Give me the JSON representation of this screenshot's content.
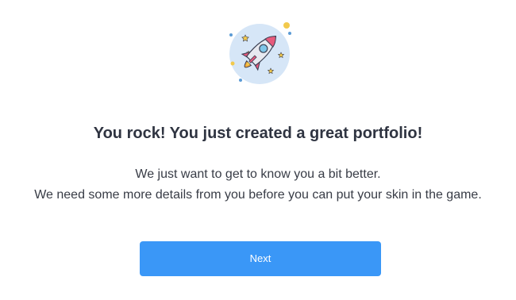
{
  "illustration": {
    "icon": "rocket-icon",
    "colors": {
      "circle": "#d6e6f7",
      "rocket_body": "#e7e9f0",
      "rocket_accent": "#e75a7c",
      "window": "#7fc6e8",
      "star": "#f2c94c",
      "flame": "#f2a93b",
      "dot_blue": "#5b9bd5"
    }
  },
  "heading": "You rock! You just created a great portfolio!",
  "message": {
    "line1": "We just want to get to know you a bit better.",
    "line2": "We need some more details from you before you can put your skin in the game."
  },
  "actions": {
    "next_label": "Next",
    "next_color": "#3a97f7"
  }
}
